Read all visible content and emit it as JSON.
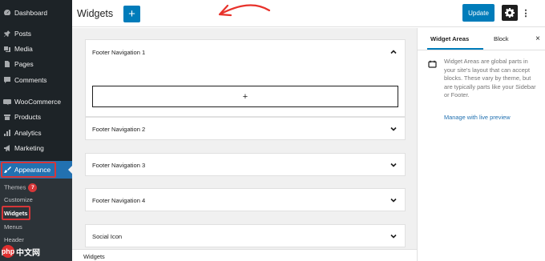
{
  "sidebar": {
    "items": [
      {
        "label": "Dashboard",
        "icon": "dashboard-icon"
      },
      {
        "label": "Posts",
        "icon": "pushpin-icon"
      },
      {
        "label": "Media",
        "icon": "media-icon"
      },
      {
        "label": "Pages",
        "icon": "page-icon"
      },
      {
        "label": "Comments",
        "icon": "comment-icon"
      },
      {
        "label": "WooCommerce",
        "icon": "woocommerce-icon"
      },
      {
        "label": "Products",
        "icon": "products-icon"
      },
      {
        "label": "Analytics",
        "icon": "analytics-icon"
      },
      {
        "label": "Marketing",
        "icon": "megaphone-icon"
      },
      {
        "label": "Appearance",
        "icon": "paintbrush-icon"
      }
    ],
    "submenu": [
      {
        "label": "Themes",
        "badge": "7"
      },
      {
        "label": "Customize"
      },
      {
        "label": "Widgets"
      },
      {
        "label": "Menus"
      },
      {
        "label": "Header"
      }
    ]
  },
  "header": {
    "title": "Widgets",
    "add_label": "+",
    "update_label": "Update",
    "more_label": "⋮"
  },
  "widget_areas": [
    {
      "title": "Footer Navigation 1",
      "expanded": true,
      "appender": "+"
    },
    {
      "title": "Footer Navigation 2",
      "expanded": false
    },
    {
      "title": "Footer Navigation 3",
      "expanded": false
    },
    {
      "title": "Footer Navigation 4",
      "expanded": false
    },
    {
      "title": "Social Icon",
      "expanded": false
    }
  ],
  "panel": {
    "tabs": [
      "Widget Areas",
      "Block"
    ],
    "active_tab": "Widget Areas",
    "close_label": "×",
    "description": "Widget Areas are global parts in your site's layout that can accept blocks. These vary by theme, but are typically parts like your Sidebar or Footer.",
    "manage_link": "Manage with live preview"
  },
  "footer": {
    "breadcrumb": "Widgets"
  },
  "watermark": {
    "logo": "php",
    "text": "中文网"
  },
  "colors": {
    "admin_bg": "#1d2327",
    "accent": "#007cba",
    "highlight": "#d63638",
    "canvas_bg": "#f0f0f0"
  }
}
